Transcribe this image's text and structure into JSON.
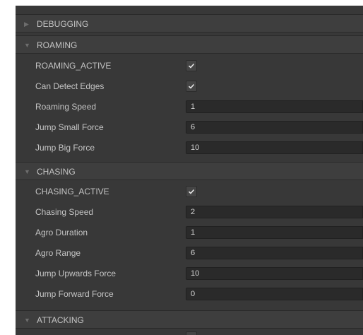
{
  "sections": {
    "debugging": {
      "title": "DEBUGGING",
      "expanded": false
    },
    "roaming": {
      "title": "ROAMING",
      "expanded": true,
      "roaming_active": {
        "label": "ROAMING_ACTIVE",
        "checked": true
      },
      "can_detect_edges": {
        "label": "Can Detect Edges",
        "checked": true
      },
      "roaming_speed": {
        "label": "Roaming Speed",
        "value": "1"
      },
      "jump_small_force": {
        "label": "Jump Small Force",
        "value": "6"
      },
      "jump_big_force": {
        "label": "Jump Big Force",
        "value": "10"
      }
    },
    "chasing": {
      "title": "CHASING",
      "expanded": true,
      "chasing_active": {
        "label": "CHASING_ACTIVE",
        "checked": true
      },
      "chasing_speed": {
        "label": "Chasing Speed",
        "value": "2"
      },
      "agro_duration": {
        "label": "Agro Duration",
        "value": "1"
      },
      "agro_range": {
        "label": "Agro Range",
        "value": "6"
      },
      "jump_upwards_force": {
        "label": "Jump Upwards Force",
        "value": "10"
      },
      "jump_forward_force": {
        "label": "Jump Forward Force",
        "value": "0"
      }
    },
    "attacking": {
      "title": "ATTACKING",
      "expanded": true
    }
  },
  "icons": {
    "collapsed": "triangle-right-icon",
    "expanded": "triangle-down-icon",
    "check": "checkmark-icon"
  },
  "colors": {
    "panel_bg": "#383838",
    "header_bg": "#3e3e3e",
    "field_bg": "#2a2a2a",
    "text": "#c4c4c4"
  }
}
